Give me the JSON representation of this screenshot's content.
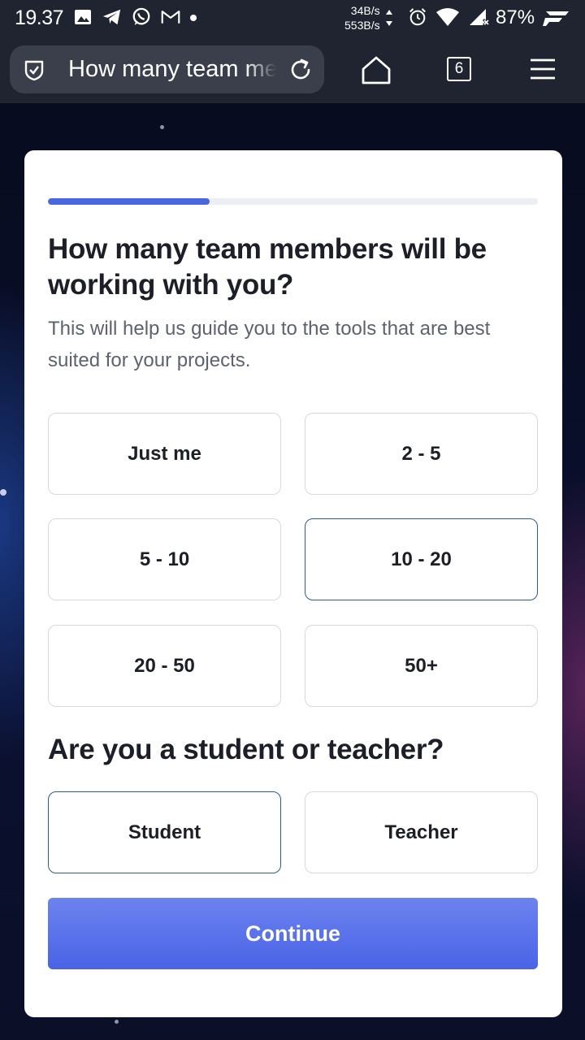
{
  "status_bar": {
    "time": "19.37",
    "net_up": "34B/s",
    "net_down": "553B/s",
    "battery": "87%",
    "icons": [
      "image-icon",
      "telegram-icon",
      "whatsapp-icon",
      "gmail-icon",
      "alarm-icon",
      "wifi-icon",
      "signal-icon",
      "brand-logo-icon"
    ]
  },
  "browser": {
    "url_text": "How many team members will be working with you?",
    "tab_count": "6"
  },
  "form": {
    "progress_fraction": 0.33,
    "question1": {
      "title": "How many team members will be working with you?",
      "description": "This will help us guide you to the tools that are best suited for your projects.",
      "options": [
        {
          "label": "Just me",
          "selected": false
        },
        {
          "label": "2 - 5",
          "selected": false
        },
        {
          "label": "5 - 10",
          "selected": false
        },
        {
          "label": "10 - 20",
          "selected": true
        },
        {
          "label": "20 - 50",
          "selected": false
        },
        {
          "label": "50+",
          "selected": false
        }
      ]
    },
    "question2": {
      "title": "Are you a student or teacher?",
      "options": [
        {
          "label": "Student",
          "selected": true
        },
        {
          "label": "Teacher",
          "selected": false
        }
      ]
    },
    "continue_label": "Continue"
  },
  "colors": {
    "accent": "#4a66e0",
    "selected_border": "#2b5c95",
    "text_dark": "#1c1f27",
    "text_muted": "#5d6270"
  }
}
